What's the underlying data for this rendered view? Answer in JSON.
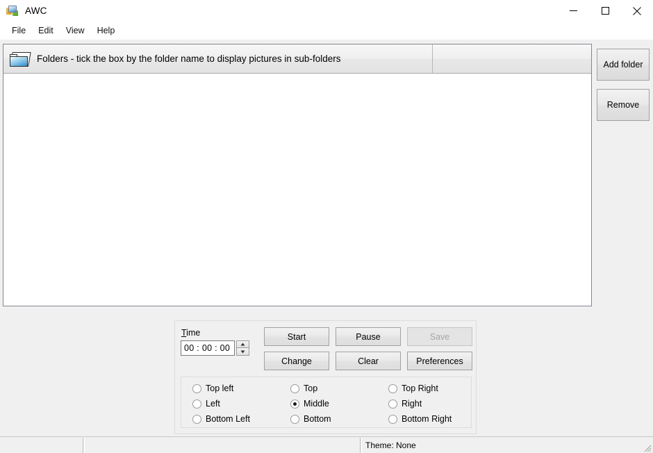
{
  "window": {
    "title": "AWC",
    "icon": "app-icon",
    "controls": {
      "minimize": "minimize-icon",
      "maximize": "maximize-icon",
      "close": "close-icon"
    }
  },
  "menubar": {
    "items": [
      {
        "label": "File"
      },
      {
        "label": "Edit"
      },
      {
        "label": "View"
      },
      {
        "label": "Help"
      }
    ]
  },
  "folder_list": {
    "icon": "folder-icon",
    "columns": [
      {
        "label": "Folders - tick the box by the folder name to display pictures in sub-folders"
      },
      {
        "label": ""
      }
    ],
    "rows": []
  },
  "side_buttons": {
    "add_folder": "Add folder",
    "remove": "Remove"
  },
  "controls": {
    "time": {
      "label_accel": "T",
      "label_rest": "ime",
      "value": "00 : 00 : 00",
      "spinner_up": "spinner-up-icon",
      "spinner_down": "spinner-down-icon"
    },
    "buttons": [
      {
        "label": "Start",
        "disabled": false
      },
      {
        "label": "Pause",
        "disabled": false
      },
      {
        "label": "Save",
        "disabled": true
      },
      {
        "label": "Change",
        "disabled": false
      },
      {
        "label": "Clear",
        "disabled": false
      },
      {
        "label": "Preferences",
        "disabled": false
      }
    ],
    "position_options": [
      {
        "label": "Top left",
        "selected": false
      },
      {
        "label": "Top",
        "selected": false
      },
      {
        "label": "Top Right",
        "selected": false
      },
      {
        "label": "Left",
        "selected": false
      },
      {
        "label": "Middle",
        "selected": true
      },
      {
        "label": "Right",
        "selected": false
      },
      {
        "label": "Bottom Left",
        "selected": false
      },
      {
        "label": "Bottom",
        "selected": false
      },
      {
        "label": "Bottom Right",
        "selected": false
      }
    ]
  },
  "statusbar": {
    "panel1": "",
    "panel2": "",
    "panel3": "Theme: None",
    "grip": "resize-grip-icon"
  }
}
